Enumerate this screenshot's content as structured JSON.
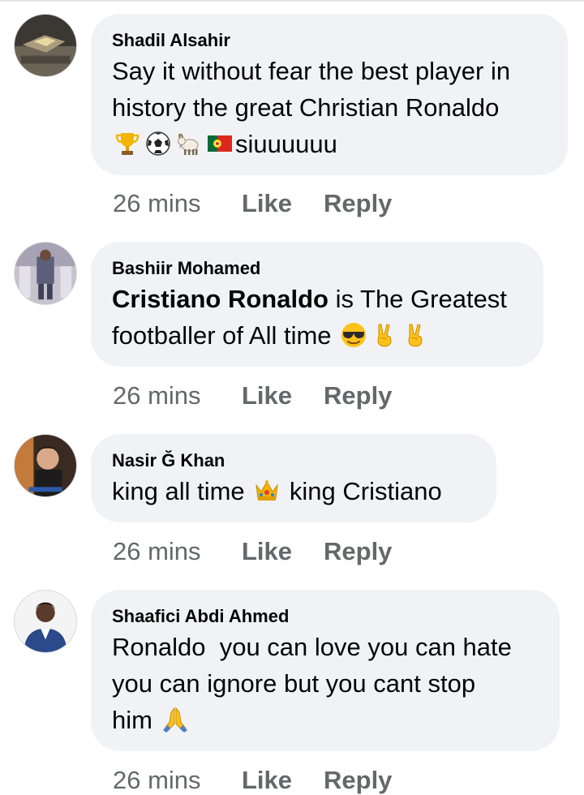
{
  "comments": [
    {
      "author": "Shadil Alsahir",
      "line1": "Say it without fear the best player in",
      "line2": "history the great Christian Ronaldo",
      "line3_suffix": "siuuuuuu",
      "emojis": [
        "trophy-emoji",
        "soccer-ball-emoji",
        "goat-emoji",
        "portugal-flag-emoji"
      ],
      "time": "26 mins",
      "like": "Like",
      "reply": "Reply"
    },
    {
      "author": "Bashiir Mohamed",
      "tag": "Cristiano Ronaldo",
      "line1_rest": " is The Greatest",
      "line2": "footballer of All time ",
      "emojis": [
        "sunglasses-face-emoji",
        "victory-hand-emoji",
        "victory-hand-emoji"
      ],
      "time": "26 mins",
      "like": "Like",
      "reply": "Reply"
    },
    {
      "author": "Nasir Ğ Khan",
      "line1_a": "king all time ",
      "line1_b": " king Cristiano",
      "emojis": [
        "crown-emoji"
      ],
      "time": "26 mins",
      "like": "Like",
      "reply": "Reply"
    },
    {
      "author": "Shaafici Abdi Ahmed",
      "line1": "Ronaldo  you can love you can hate",
      "line2": "you can ignore but you cant stop",
      "line3": "him ",
      "emojis": [
        "folded-hands-emoji"
      ],
      "time": "26 mins",
      "like": "Like",
      "reply": "Reply"
    }
  ],
  "colors": {
    "bubble": "#f0f2f5",
    "secondary_text": "#65676b",
    "primary_text": "#050505"
  }
}
